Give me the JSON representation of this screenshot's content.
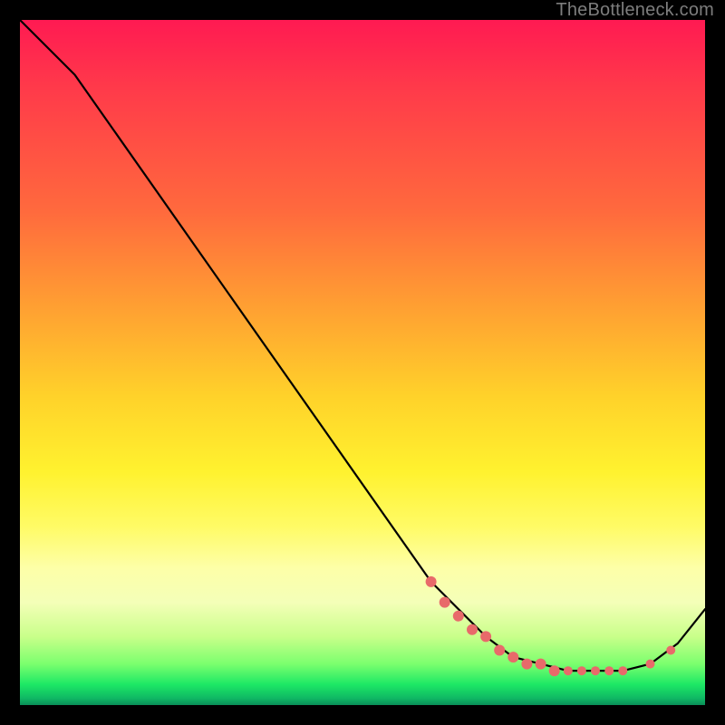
{
  "watermark": "TheBottleneck.com",
  "chart_data": {
    "type": "line",
    "title": "",
    "xlabel": "",
    "ylabel": "",
    "xlim": [
      0,
      100
    ],
    "ylim": [
      0,
      100
    ],
    "series": [
      {
        "name": "curve",
        "x": [
          0,
          8,
          60,
          68,
          72,
          76,
          80,
          84,
          88,
          92,
          96,
          100
        ],
        "y": [
          100,
          92,
          18,
          10,
          7,
          6,
          5,
          5,
          5,
          6,
          9,
          14
        ]
      }
    ],
    "markers": {
      "name": "highlight-dots",
      "color": "#e86a6a",
      "x": [
        60,
        62,
        64,
        66,
        68,
        70,
        72,
        74,
        76,
        78,
        80,
        82,
        84,
        86,
        88,
        92,
        95
      ],
      "y": [
        18,
        15,
        13,
        11,
        10,
        8,
        7,
        6,
        6,
        5,
        5,
        5,
        5,
        5,
        5,
        6,
        8
      ]
    },
    "background_gradient": {
      "top": "#ff1a52",
      "mid": "#ffe23a",
      "bottom": "#0fb864"
    }
  }
}
